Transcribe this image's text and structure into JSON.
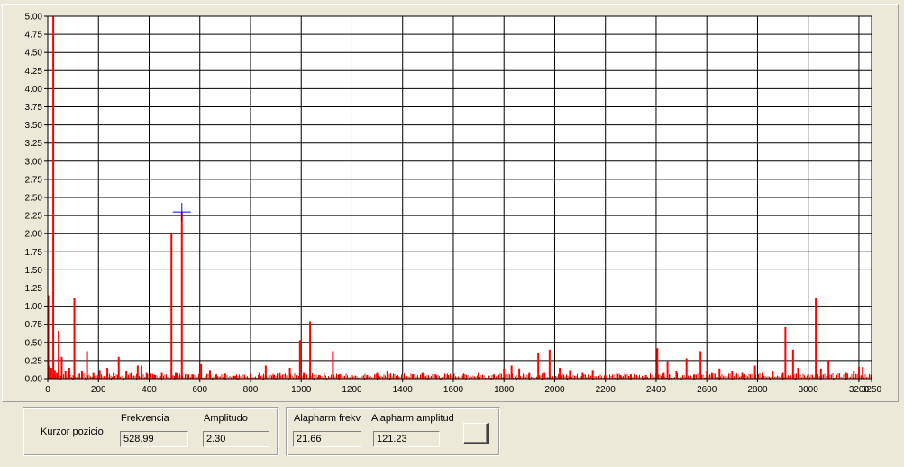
{
  "chart_data": {
    "type": "bar",
    "title": "",
    "xlabel": "",
    "ylabel": "",
    "xlim": [
      0,
      3250
    ],
    "ylim": [
      0,
      5
    ],
    "x_ticks": [
      0,
      200,
      400,
      600,
      800,
      1000,
      1200,
      1400,
      1600,
      1800,
      2000,
      2200,
      2400,
      2600,
      2800,
      3000,
      3200,
      3250
    ],
    "y_ticks": [
      "0.00",
      "0.25",
      "0.50",
      "0.75",
      "1.00",
      "1.25",
      "1.50",
      "1.75",
      "2.00",
      "2.25",
      "2.50",
      "2.75",
      "3.00",
      "3.25",
      "3.50",
      "3.75",
      "4.00",
      "4.25",
      "4.50",
      "4.75",
      "5.00"
    ],
    "grid": true,
    "series_color": "#ff0000",
    "cursor_color": "#0000ff",
    "cursor": {
      "x": 528.99,
      "y": 2.3
    },
    "series": [
      {
        "values": [
          [
            2,
            1.15
          ],
          [
            7,
            0.18
          ],
          [
            14,
            0.15
          ],
          [
            21.66,
            5.0
          ],
          [
            28,
            0.12
          ],
          [
            36,
            0.08
          ],
          [
            43,
            0.66
          ],
          [
            55,
            0.3
          ],
          [
            70,
            0.1
          ],
          [
            85,
            0.15
          ],
          [
            105,
            1.12
          ],
          [
            120,
            0.06
          ],
          [
            135,
            0.1
          ],
          [
            155,
            0.38
          ],
          [
            180,
            0.08
          ],
          [
            205,
            0.12
          ],
          [
            235,
            0.15
          ],
          [
            260,
            0.08
          ],
          [
            280,
            0.3
          ],
          [
            310,
            0.1
          ],
          [
            330,
            0.08
          ],
          [
            355,
            0.18
          ],
          [
            370,
            0.18
          ],
          [
            390,
            0.08
          ],
          [
            420,
            0.05
          ],
          [
            450,
            0.08
          ],
          [
            488,
            2.0
          ],
          [
            505,
            0.08
          ],
          [
            528.99,
            2.3
          ],
          [
            555,
            0.06
          ],
          [
            570,
            0.06
          ],
          [
            605,
            0.2
          ],
          [
            640,
            0.12
          ],
          [
            665,
            0.06
          ],
          [
            700,
            0.07
          ],
          [
            740,
            0.04
          ],
          [
            800,
            0.06
          ],
          [
            835,
            0.08
          ],
          [
            860,
            0.18
          ],
          [
            890,
            0.05
          ],
          [
            915,
            0.08
          ],
          [
            955,
            0.15
          ],
          [
            995,
            0.53
          ],
          [
            1010,
            0.08
          ],
          [
            1035,
            0.79
          ],
          [
            1070,
            0.05
          ],
          [
            1125,
            0.38
          ],
          [
            1150,
            0.06
          ],
          [
            1200,
            0.05
          ],
          [
            1260,
            0.05
          ],
          [
            1300,
            0.08
          ],
          [
            1340,
            0.1
          ],
          [
            1380,
            0.05
          ],
          [
            1440,
            0.06
          ],
          [
            1480,
            0.08
          ],
          [
            1530,
            0.06
          ],
          [
            1580,
            0.05
          ],
          [
            1640,
            0.06
          ],
          [
            1700,
            0.08
          ],
          [
            1760,
            0.06
          ],
          [
            1800,
            0.14
          ],
          [
            1830,
            0.18
          ],
          [
            1860,
            0.14
          ],
          [
            1900,
            0.08
          ],
          [
            1935,
            0.35
          ],
          [
            1960,
            0.08
          ],
          [
            1980,
            0.4
          ],
          [
            2020,
            0.15
          ],
          [
            2060,
            0.12
          ],
          [
            2110,
            0.08
          ],
          [
            2150,
            0.12
          ],
          [
            2200,
            0.05
          ],
          [
            2260,
            0.05
          ],
          [
            2300,
            0.06
          ],
          [
            2360,
            0.05
          ],
          [
            2405,
            0.42
          ],
          [
            2430,
            0.08
          ],
          [
            2445,
            0.24
          ],
          [
            2480,
            0.1
          ],
          [
            2520,
            0.28
          ],
          [
            2550,
            0.06
          ],
          [
            2575,
            0.38
          ],
          [
            2600,
            0.1
          ],
          [
            2620,
            0.08
          ],
          [
            2650,
            0.14
          ],
          [
            2700,
            0.1
          ],
          [
            2740,
            0.08
          ],
          [
            2790,
            0.18
          ],
          [
            2820,
            0.08
          ],
          [
            2860,
            0.1
          ],
          [
            2900,
            0.08
          ],
          [
            2910,
            0.71
          ],
          [
            2940,
            0.4
          ],
          [
            2960,
            0.15
          ],
          [
            3000,
            0.06
          ],
          [
            3030,
            1.11
          ],
          [
            3050,
            0.14
          ],
          [
            3080,
            0.26
          ],
          [
            3150,
            0.08
          ],
          [
            3180,
            0.1
          ],
          [
            3200,
            0.16
          ],
          [
            3215,
            0.16
          ]
        ]
      }
    ]
  },
  "panels": {
    "cursor_position": {
      "label": "Kurzor pozicio",
      "freq_header": "Frekvencia",
      "amp_header": "Amplitudo",
      "freq_value": "528.99",
      "amp_value": "2.30"
    },
    "fundamental": {
      "freq_header": "Alapharm frekv",
      "amp_header": "Alapharm amplitud",
      "freq_value": "21.66",
      "amp_value": "121.23"
    }
  }
}
